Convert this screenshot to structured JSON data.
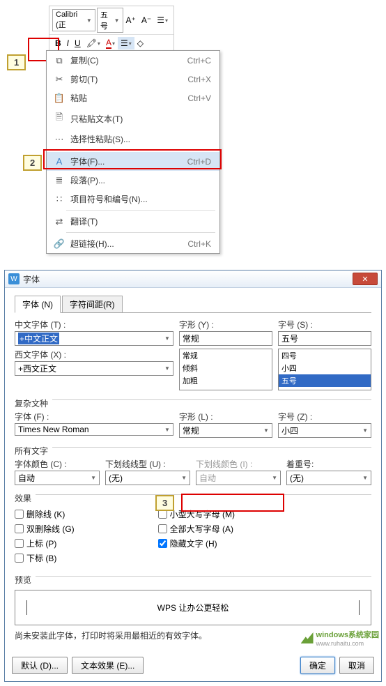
{
  "toolbar": {
    "font_name": "Calibri (正",
    "font_size": "五号",
    "increase_font": "A⁺",
    "decrease_font": "A⁻",
    "bold": "B",
    "italic": "I",
    "underline": "U"
  },
  "markers": {
    "m1": "1",
    "m2": "2",
    "m3": "3"
  },
  "context_menu": {
    "copy": {
      "label": "复制(C)",
      "shortcut": "Ctrl+C"
    },
    "cut": {
      "label": "剪切(T)",
      "shortcut": "Ctrl+X"
    },
    "paste": {
      "label": "粘贴",
      "shortcut": "Ctrl+V"
    },
    "paste_text": {
      "label": "只粘贴文本(T)"
    },
    "paste_special": {
      "label": "选择性粘贴(S)..."
    },
    "font": {
      "label": "字体(F)...",
      "shortcut": "Ctrl+D"
    },
    "paragraph": {
      "label": "段落(P)..."
    },
    "bullets": {
      "label": "项目符号和编号(N)..."
    },
    "translate": {
      "label": "翻译(T)"
    },
    "hyperlink": {
      "label": "超链接(H)...",
      "shortcut": "Ctrl+K"
    }
  },
  "dialog": {
    "title": "字体",
    "tabs": {
      "font": "字体 (N)",
      "spacing": "字符间距(R)"
    },
    "cn_font_label": "中文字体 (T) :",
    "cn_font_value": "+中文正文",
    "style_label": "字形 (Y) :",
    "style_value": "常规",
    "style_options": [
      "常规",
      "倾斜",
      "加粗"
    ],
    "size_label": "字号 (S) :",
    "size_value": "五号",
    "size_options": [
      "四号",
      "小四",
      "五号"
    ],
    "en_font_label": "西文字体 (X) :",
    "en_font_value": "+西文正文",
    "complex_label": "复杂文种",
    "complex_font_label": "字体 (F) :",
    "complex_font_value": "Times New Roman",
    "complex_style_label": "字形 (L) :",
    "complex_style_value": "常规",
    "complex_size_label": "字号 (Z) :",
    "complex_size_value": "小四",
    "all_text_label": "所有文字",
    "color_label": "字体颜色 (C) :",
    "color_value": "自动",
    "underline_label": "下划线线型 (U) :",
    "underline_value": "(无)",
    "underline_color_label": "下划线颜色 (I) :",
    "underline_color_value": "自动",
    "emphasis_label": "着重号:",
    "emphasis_value": "(无)",
    "effects_label": "效果",
    "effects": {
      "strike": "删除线 (K)",
      "dstrike": "双删除线 (G)",
      "super": "上标 (P)",
      "sub": "下标 (B)",
      "smallcaps": "小型大写字母 (M)",
      "allcaps": "全部大写字母 (A)",
      "hidden": "隐藏文字 (H)"
    },
    "preview_label": "预览",
    "preview_text": "WPS 让办公更轻松",
    "note": "尚未安装此字体，打印时将采用最相近的有效字体。",
    "buttons": {
      "default": "默认 (D)...",
      "text_effects": "文本效果 (E)...",
      "ok": "确定",
      "cancel": "取消"
    }
  },
  "watermark": {
    "text": "windows系统家园",
    "url": "www.ruhaitu.com"
  }
}
